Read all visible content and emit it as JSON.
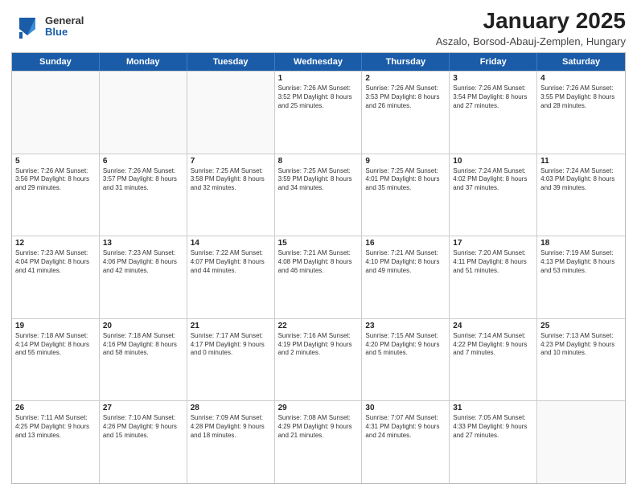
{
  "logo": {
    "general": "General",
    "blue": "Blue"
  },
  "title": "January 2025",
  "subtitle": "Aszalo, Borsod-Abauj-Zemplen, Hungary",
  "days": [
    "Sunday",
    "Monday",
    "Tuesday",
    "Wednesday",
    "Thursday",
    "Friday",
    "Saturday"
  ],
  "weeks": [
    [
      {
        "day": "",
        "content": ""
      },
      {
        "day": "",
        "content": ""
      },
      {
        "day": "",
        "content": ""
      },
      {
        "day": "1",
        "content": "Sunrise: 7:26 AM\nSunset: 3:52 PM\nDaylight: 8 hours\nand 25 minutes."
      },
      {
        "day": "2",
        "content": "Sunrise: 7:26 AM\nSunset: 3:53 PM\nDaylight: 8 hours\nand 26 minutes."
      },
      {
        "day": "3",
        "content": "Sunrise: 7:26 AM\nSunset: 3:54 PM\nDaylight: 8 hours\nand 27 minutes."
      },
      {
        "day": "4",
        "content": "Sunrise: 7:26 AM\nSunset: 3:55 PM\nDaylight: 8 hours\nand 28 minutes."
      }
    ],
    [
      {
        "day": "5",
        "content": "Sunrise: 7:26 AM\nSunset: 3:56 PM\nDaylight: 8 hours\nand 29 minutes."
      },
      {
        "day": "6",
        "content": "Sunrise: 7:26 AM\nSunset: 3:57 PM\nDaylight: 8 hours\nand 31 minutes."
      },
      {
        "day": "7",
        "content": "Sunrise: 7:25 AM\nSunset: 3:58 PM\nDaylight: 8 hours\nand 32 minutes."
      },
      {
        "day": "8",
        "content": "Sunrise: 7:25 AM\nSunset: 3:59 PM\nDaylight: 8 hours\nand 34 minutes."
      },
      {
        "day": "9",
        "content": "Sunrise: 7:25 AM\nSunset: 4:01 PM\nDaylight: 8 hours\nand 35 minutes."
      },
      {
        "day": "10",
        "content": "Sunrise: 7:24 AM\nSunset: 4:02 PM\nDaylight: 8 hours\nand 37 minutes."
      },
      {
        "day": "11",
        "content": "Sunrise: 7:24 AM\nSunset: 4:03 PM\nDaylight: 8 hours\nand 39 minutes."
      }
    ],
    [
      {
        "day": "12",
        "content": "Sunrise: 7:23 AM\nSunset: 4:04 PM\nDaylight: 8 hours\nand 41 minutes."
      },
      {
        "day": "13",
        "content": "Sunrise: 7:23 AM\nSunset: 4:06 PM\nDaylight: 8 hours\nand 42 minutes."
      },
      {
        "day": "14",
        "content": "Sunrise: 7:22 AM\nSunset: 4:07 PM\nDaylight: 8 hours\nand 44 minutes."
      },
      {
        "day": "15",
        "content": "Sunrise: 7:21 AM\nSunset: 4:08 PM\nDaylight: 8 hours\nand 46 minutes."
      },
      {
        "day": "16",
        "content": "Sunrise: 7:21 AM\nSunset: 4:10 PM\nDaylight: 8 hours\nand 49 minutes."
      },
      {
        "day": "17",
        "content": "Sunrise: 7:20 AM\nSunset: 4:11 PM\nDaylight: 8 hours\nand 51 minutes."
      },
      {
        "day": "18",
        "content": "Sunrise: 7:19 AM\nSunset: 4:13 PM\nDaylight: 8 hours\nand 53 minutes."
      }
    ],
    [
      {
        "day": "19",
        "content": "Sunrise: 7:18 AM\nSunset: 4:14 PM\nDaylight: 8 hours\nand 55 minutes."
      },
      {
        "day": "20",
        "content": "Sunrise: 7:18 AM\nSunset: 4:16 PM\nDaylight: 8 hours\nand 58 minutes."
      },
      {
        "day": "21",
        "content": "Sunrise: 7:17 AM\nSunset: 4:17 PM\nDaylight: 9 hours\nand 0 minutes."
      },
      {
        "day": "22",
        "content": "Sunrise: 7:16 AM\nSunset: 4:19 PM\nDaylight: 9 hours\nand 2 minutes."
      },
      {
        "day": "23",
        "content": "Sunrise: 7:15 AM\nSunset: 4:20 PM\nDaylight: 9 hours\nand 5 minutes."
      },
      {
        "day": "24",
        "content": "Sunrise: 7:14 AM\nSunset: 4:22 PM\nDaylight: 9 hours\nand 7 minutes."
      },
      {
        "day": "25",
        "content": "Sunrise: 7:13 AM\nSunset: 4:23 PM\nDaylight: 9 hours\nand 10 minutes."
      }
    ],
    [
      {
        "day": "26",
        "content": "Sunrise: 7:11 AM\nSunset: 4:25 PM\nDaylight: 9 hours\nand 13 minutes."
      },
      {
        "day": "27",
        "content": "Sunrise: 7:10 AM\nSunset: 4:26 PM\nDaylight: 9 hours\nand 15 minutes."
      },
      {
        "day": "28",
        "content": "Sunrise: 7:09 AM\nSunset: 4:28 PM\nDaylight: 9 hours\nand 18 minutes."
      },
      {
        "day": "29",
        "content": "Sunrise: 7:08 AM\nSunset: 4:29 PM\nDaylight: 9 hours\nand 21 minutes."
      },
      {
        "day": "30",
        "content": "Sunrise: 7:07 AM\nSunset: 4:31 PM\nDaylight: 9 hours\nand 24 minutes."
      },
      {
        "day": "31",
        "content": "Sunrise: 7:05 AM\nSunset: 4:33 PM\nDaylight: 9 hours\nand 27 minutes."
      },
      {
        "day": "",
        "content": ""
      }
    ]
  ]
}
